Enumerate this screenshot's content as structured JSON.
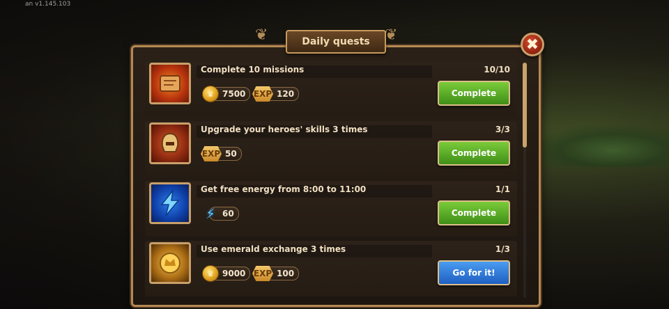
{
  "version": "an v1.145.103",
  "dialog": {
    "title": "Daily quests",
    "close_glyph": "✖"
  },
  "quests": [
    {
      "title": "Complete 10 missions",
      "progress": "10/10",
      "icon": "scroll-icon",
      "rewards": [
        {
          "type": "coin",
          "amount": "7500"
        },
        {
          "type": "exp",
          "label": "EXP",
          "amount": "120"
        }
      ],
      "button": "Complete",
      "button_color": "#4f9f22"
    },
    {
      "title": "Upgrade your heroes' skills 3 times",
      "progress": "3/3",
      "icon": "helmet-icon",
      "rewards": [
        {
          "type": "exp",
          "label": "EXP",
          "amount": "50"
        }
      ],
      "button": "Complete",
      "button_color": "#4f9f22"
    },
    {
      "title": "Get free energy from 8:00 to 11:00",
      "progress": "1/1",
      "icon": "energy-icon",
      "rewards": [
        {
          "type": "energy",
          "amount": "60"
        }
      ],
      "button": "Complete",
      "button_color": "#4f9f22"
    },
    {
      "title": "Use emerald exchange 3 times",
      "progress": "1/3",
      "icon": "gold-coin-icon",
      "rewards": [
        {
          "type": "coin",
          "amount": "9000"
        },
        {
          "type": "exp",
          "label": "EXP",
          "amount": "100"
        }
      ],
      "button": "Go for it!",
      "button_color": "#2f74d6"
    }
  ]
}
